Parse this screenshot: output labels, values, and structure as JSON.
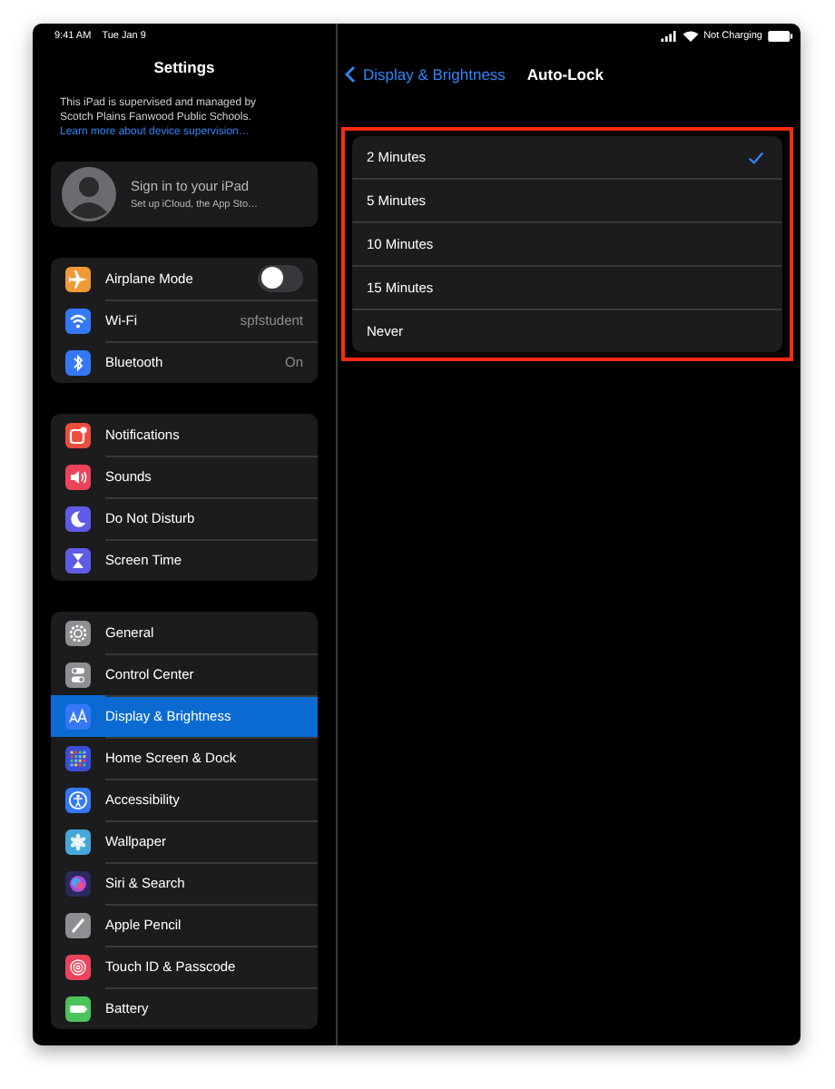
{
  "status_bar": {
    "time": "9:41 AM",
    "date": "Tue Jan 9",
    "charging": "Not Charging"
  },
  "sidebar": {
    "title": "Settings",
    "notice": {
      "text": "This iPad is supervised and managed by Scotch Plains Fanwood Public Schools.",
      "link": "Learn more about device supervision…"
    },
    "account": {
      "title": "Sign in to your iPad",
      "subtitle": "Set up iCloud, the App Sto…"
    },
    "groups": [
      {
        "items": [
          {
            "label": "Airplane Mode",
            "kind": "airplane",
            "color": "#f09a37",
            "on": false,
            "selected": false
          },
          {
            "label": "Wi-Fi",
            "kind": "wifi",
            "color": "#3478f6",
            "value": "spfstudent",
            "selected": false
          },
          {
            "label": "Bluetooth",
            "kind": "bluetooth",
            "color": "#3478f6",
            "value": "On",
            "selected": false
          }
        ]
      },
      {
        "items": [
          {
            "label": "Notifications",
            "kind": "bell",
            "color": "#eb4e3d",
            "selected": false
          },
          {
            "label": "Sounds",
            "kind": "speaker",
            "color": "#eb445a",
            "selected": false
          },
          {
            "label": "Do Not Disturb",
            "kind": "moon",
            "color": "#5e5ce6",
            "selected": false
          },
          {
            "label": "Screen Time",
            "kind": "hourglass",
            "color": "#5e5ce6",
            "selected": false
          }
        ]
      },
      {
        "items": [
          {
            "label": "General",
            "kind": "gear",
            "color": "#8e8e93",
            "selected": false
          },
          {
            "label": "Control Center",
            "kind": "switches",
            "color": "#8e8e93",
            "selected": false
          },
          {
            "label": "Display & Brightness",
            "kind": "text",
            "color": "#3478f6",
            "selected": true
          },
          {
            "label": "Home Screen & Dock",
            "kind": "grid",
            "color": "#3a4fd6",
            "selected": false
          },
          {
            "label": "Accessibility",
            "kind": "person",
            "color": "#3478f6",
            "selected": false
          },
          {
            "label": "Wallpaper",
            "kind": "flower",
            "color": "#45a7d8",
            "selected": false
          },
          {
            "label": "Siri & Search",
            "kind": "orb",
            "color": "#2a2a5e",
            "selected": false
          },
          {
            "label": "Apple Pencil",
            "kind": "pencil",
            "color": "#8e8e93",
            "selected": false
          },
          {
            "label": "Touch ID & Passcode",
            "kind": "fingerprint",
            "color": "#eb445a",
            "selected": false
          },
          {
            "label": "Battery",
            "kind": "battery",
            "color": "#4cc35a",
            "selected": false
          }
        ]
      }
    ]
  },
  "detail": {
    "back": "Display & Brightness",
    "title": "Auto-Lock",
    "options": [
      {
        "label": "2 Minutes",
        "selected": true
      },
      {
        "label": "5 Minutes",
        "selected": false
      },
      {
        "label": "10 Minutes",
        "selected": false
      },
      {
        "label": "15 Minutes",
        "selected": false
      },
      {
        "label": "Never",
        "selected": false
      }
    ]
  }
}
